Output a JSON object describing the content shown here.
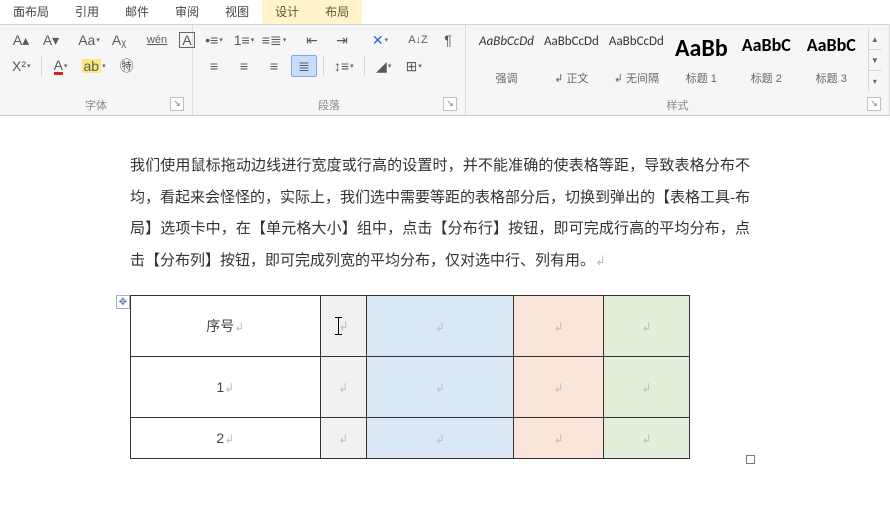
{
  "tabs": {
    "items": [
      {
        "label": "面布局"
      },
      {
        "label": "引用"
      },
      {
        "label": "邮件"
      },
      {
        "label": "审阅"
      },
      {
        "label": "视图"
      },
      {
        "label": "设计"
      },
      {
        "label": "布局"
      }
    ]
  },
  "ribbon": {
    "font_group": {
      "label": "字体"
    },
    "para_group": {
      "label": "段落"
    },
    "styles_group": {
      "label": "样式"
    }
  },
  "icons": {
    "grow_font": "A▴",
    "shrink_font": "A▾",
    "change_case": "Aa",
    "clear_fmt": "Aᵪ",
    "phonetic": "wén",
    "char_border": "A",
    "superscript": "X²",
    "font_color": "A",
    "char_shading": "ab",
    "enclose": "㊕",
    "bullets": "•≡",
    "numbering": "1≡",
    "multilevel": "≡≣",
    "dec_indent": "⇤",
    "inc_indent": "⇥",
    "sort": "A↓Z",
    "show_marks": "¶",
    "align_left": "≡",
    "align_center": "≡",
    "align_right": "≡",
    "align_dist": "≣",
    "line_spacing": "↕≡",
    "shading": "◢",
    "borders": "⊞",
    "asian_layout": "✕"
  },
  "styles": [
    {
      "preview": "AaBbCcDd",
      "name": "强调",
      "size": "13px",
      "italic": true,
      "color": "#333"
    },
    {
      "preview": "AaBbCcDd",
      "name": "↲ 正文",
      "size": "13px",
      "italic": false,
      "color": "#333"
    },
    {
      "preview": "AaBbCcDd",
      "name": "↲ 无间隔",
      "size": "13px",
      "italic": false,
      "color": "#333"
    },
    {
      "preview": "AaBb",
      "name": "标题 1",
      "size": "24px",
      "italic": false,
      "color": "#000",
      "bold": true
    },
    {
      "preview": "AaBbC",
      "name": "标题 2",
      "size": "18px",
      "italic": false,
      "color": "#000",
      "bold": true
    },
    {
      "preview": "AaBbC",
      "name": "标题 3",
      "size": "18px",
      "italic": false,
      "color": "#000",
      "bold": true
    }
  ],
  "document": {
    "paragraph": "我们使用鼠标拖动边线进行宽度或行高的设置时，并不能准确的使表格等距，导致表格分布不均，看起来会怪怪的，实际上，我们选中需要等距的表格部分后，切换到弹出的【表格工具-布局】选项卡中，在【单元格大小】组中，点击【分布行】按钮，即可完成行高的平均分布，点击【分布列】按钮，即可完成列宽的平均分布，仅对选中行、列有用。",
    "end_mark": "↲",
    "cell_mark": "↲",
    "table": {
      "cols": [
        "narrow",
        "gray",
        "blue",
        "orange",
        "green"
      ],
      "rows": [
        {
          "c0": "序号",
          "cursor_in": 1
        },
        {
          "c0": "1"
        },
        {
          "c0": "2"
        }
      ]
    }
  }
}
